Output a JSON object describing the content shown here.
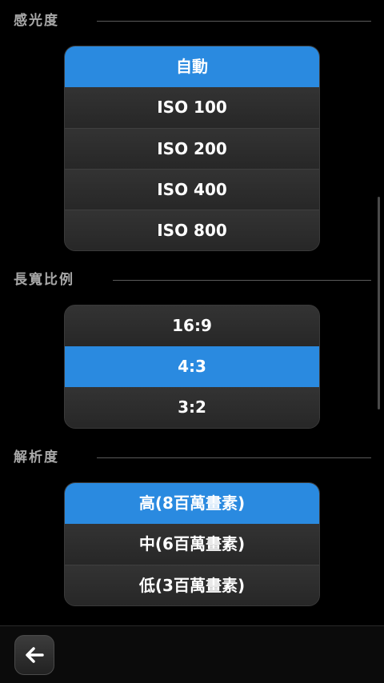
{
  "sections": {
    "iso": {
      "title": "感光度",
      "options": [
        "自動",
        "ISO 100",
        "ISO 200",
        "ISO 400",
        "ISO 800"
      ],
      "selected": "自動"
    },
    "aspect": {
      "title": "長寬比例",
      "options": [
        "16:9",
        "4:3",
        "3:2"
      ],
      "selected": "4:3"
    },
    "resolution": {
      "title": "解析度",
      "options": [
        "高(8百萬畫素)",
        "中(6百萬畫素)",
        "低(3百萬畫素)"
      ],
      "selected": "高(8百萬畫素)"
    }
  },
  "bottom_bar": {
    "back_icon": "back-arrow-icon"
  },
  "colors": {
    "accent": "#2a8ae0",
    "background": "#000000",
    "section_title": "#a8a8a8"
  }
}
